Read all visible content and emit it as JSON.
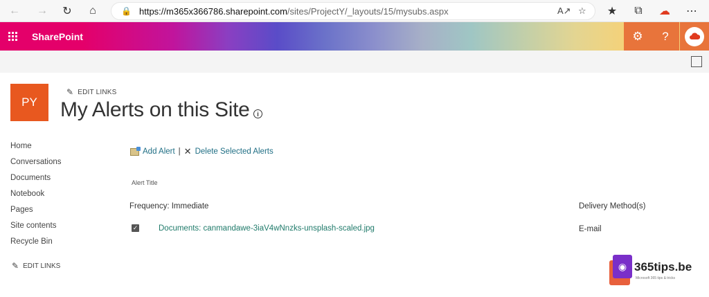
{
  "browser": {
    "url_domain": "https://m365x366786.sharepoint.com",
    "url_path": "/sites/ProjectY/_layouts/15/mysubs.aspx",
    "icons": [
      "back-icon",
      "forward-icon",
      "refresh-icon",
      "home-icon",
      "lock-icon",
      "read-aloud-icon",
      "add-favorite-icon",
      "favorites-icon",
      "collections-icon",
      "cloud-icon",
      "more-icon"
    ]
  },
  "suite": {
    "app_name": "SharePoint",
    "icons": [
      "waffle-icon",
      "settings-icon",
      "help-icon",
      "account-icon"
    ],
    "accent": "#e4006a",
    "orange": "#e8743b"
  },
  "site": {
    "logo_initials": "PY",
    "logo_color": "#e8581f",
    "edit_links": "EDIT LINKS",
    "page_title": "My Alerts on this Site"
  },
  "nav": {
    "items": [
      "Home",
      "Conversations",
      "Documents",
      "Notebook",
      "Pages",
      "Site contents",
      "Recycle Bin"
    ],
    "edit_links": "EDIT LINKS"
  },
  "main": {
    "add_alert": "Add Alert",
    "separator": "|",
    "delete_alerts": "Delete Selected Alerts",
    "column_alert_title": "Alert Title",
    "frequency_label": "Frequency: Immediate",
    "delivery_header": "Delivery Method(s)",
    "alerts": [
      {
        "title": "Documents: canmandawe-3iaV4wNnzks-unsplash-scaled.jpg",
        "method": "E-mail",
        "checked": true
      }
    ],
    "link_color": "#1f7a6a"
  },
  "watermark": {
    "name": "365tips.be",
    "sub": "Microsoft 365 tips & tricks"
  }
}
